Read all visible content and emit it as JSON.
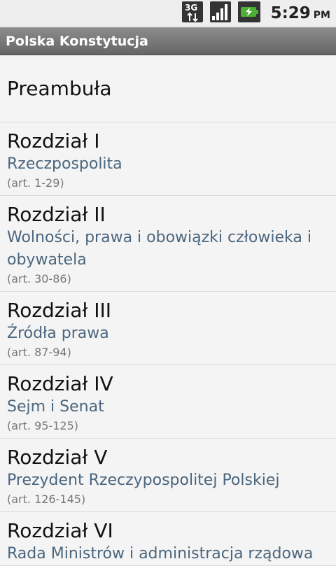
{
  "status": {
    "network_label": "3G",
    "time": "5:29",
    "ampm": "PM"
  },
  "app": {
    "title": "Polska Konstytucja"
  },
  "items": [
    {
      "title": "Preambuła"
    },
    {
      "title": "Rozdział I",
      "subtitle": "Rzeczpospolita",
      "range": "(art. 1-29)"
    },
    {
      "title": "Rozdział II",
      "subtitle": "Wolności, prawa i obowiązki człowieka i obywatela",
      "range": "(art. 30-86)"
    },
    {
      "title": "Rozdział III",
      "subtitle": "Źródła prawa",
      "range": "(art. 87-94)"
    },
    {
      "title": "Rozdział IV",
      "subtitle": "Sejm i Senat",
      "range": "(art. 95-125)"
    },
    {
      "title": "Rozdział V",
      "subtitle": "Prezydent Rzeczypospolitej Polskiej",
      "range": "(art. 126-145)"
    },
    {
      "title": "Rozdział VI",
      "subtitle": "Rada Ministrów i administracja rządowa"
    }
  ]
}
